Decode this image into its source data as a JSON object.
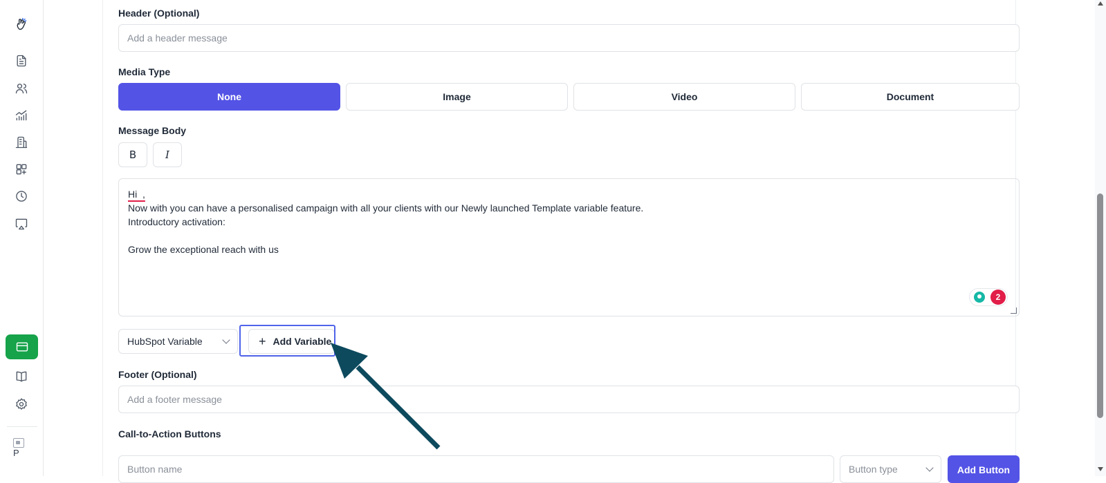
{
  "sidebar": {
    "items": [
      {
        "name": "logo-icon"
      },
      {
        "name": "document-icon"
      },
      {
        "name": "users-icon"
      },
      {
        "name": "analytics-icon"
      },
      {
        "name": "building-icon"
      },
      {
        "name": "add-widget-icon"
      },
      {
        "name": "clock-icon"
      },
      {
        "name": "cast-icon"
      },
      {
        "name": "card-icon",
        "active": true
      },
      {
        "name": "book-icon"
      },
      {
        "name": "settings-icon"
      }
    ],
    "profile_alt": "P"
  },
  "form": {
    "header": {
      "label": "Header (Optional)",
      "placeholder": "Add a header message"
    },
    "media_type": {
      "label": "Media Type",
      "options": [
        "None",
        "Image",
        "Video",
        "Document"
      ],
      "selected": "None"
    },
    "message_body": {
      "label": "Message Body",
      "bold_label": "B",
      "italic_label": "I",
      "lines": [
        "Hi  ,",
        "Now with you can have a personalised campaign with all your clients with our Newly launched Template variable feature.",
        "Introductory activation:",
        "",
        "Grow the exceptional reach with us"
      ],
      "grammar_issue_count": "2"
    },
    "variable": {
      "select_value": "HubSpot Variable",
      "add_label": "Add Variable",
      "add_icon": "+"
    },
    "footer": {
      "label": "Footer (Optional)",
      "placeholder": "Add a footer message"
    },
    "cta": {
      "label": "Call-to-Action Buttons",
      "name_placeholder": "Button name",
      "type_placeholder": "Button type",
      "add_label": "Add Button"
    }
  },
  "colors": {
    "primary": "#5353e6",
    "sidebar_active": "#16a34a",
    "annotation_arrow": "#0d4a5e",
    "highlight": "#4f63e9"
  }
}
